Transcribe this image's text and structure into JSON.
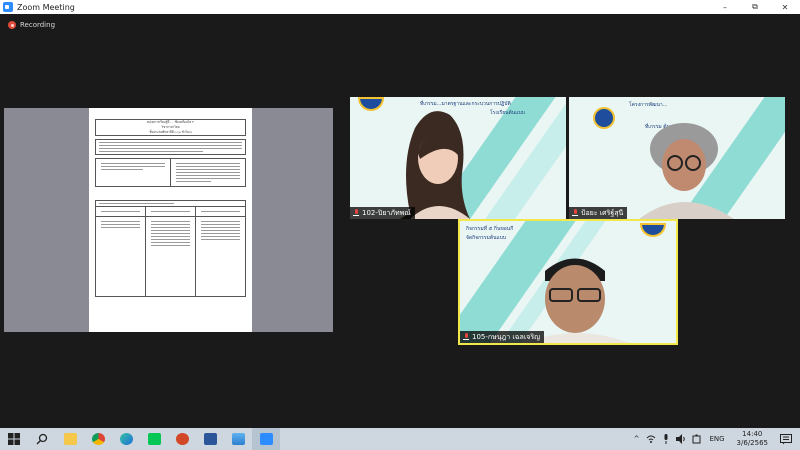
{
  "window": {
    "title": "Zoom Meeting",
    "controls": {
      "minimize": "–",
      "maximize": "⧉",
      "close": "✕"
    }
  },
  "recording": {
    "label": "Recording",
    "color": "#e04a3a"
  },
  "shared_document": {
    "title_lines": [
      "หน่วยการเรียนรู้ที่ ... \"ฝึกเคลื่อนไหว\"",
      "วิชาภาษาไทย",
      "ชั้นประถมศึกษาปีที่ ๓ (๓ ชั่วโมง)"
    ]
  },
  "participants": [
    {
      "name": "102-ปิยาภัทพณ์",
      "muted": true,
      "banner_text": "ที่เกรรม...มาตรฐานและกระบวนการปฏิบัติ",
      "banner_sub": "โรงเรียนต้นแบบ"
    },
    {
      "name": "ป้อยะ เศริฐ์สุนี",
      "muted": true,
      "banner_text": "โครงการพัฒนา...",
      "banner_sub": "ที่เกรรม ต้นแบบ"
    },
    {
      "name": "105-กษนุฎา เฉลเจริญ",
      "muted": true,
      "banner_text": "กิจกรรมที่ ๕ กิ่นขอนกี",
      "banner_sub": "จัดกิจกรรมต้นแบบ"
    }
  ],
  "taskbar": {
    "apps": [
      "start",
      "search",
      "file-explorer",
      "chrome",
      "edge",
      "line",
      "powerpoint",
      "word",
      "photos",
      "zoom"
    ],
    "tray": {
      "chevron": "^",
      "language": "ENG"
    },
    "time": "14:40",
    "date": "3/6/2565"
  },
  "colors": {
    "accent": "#2d8cff",
    "active_speaker_border": "#f2e84a",
    "tile_background": "#e9f4f2",
    "stripe": "#7fd6cf"
  }
}
